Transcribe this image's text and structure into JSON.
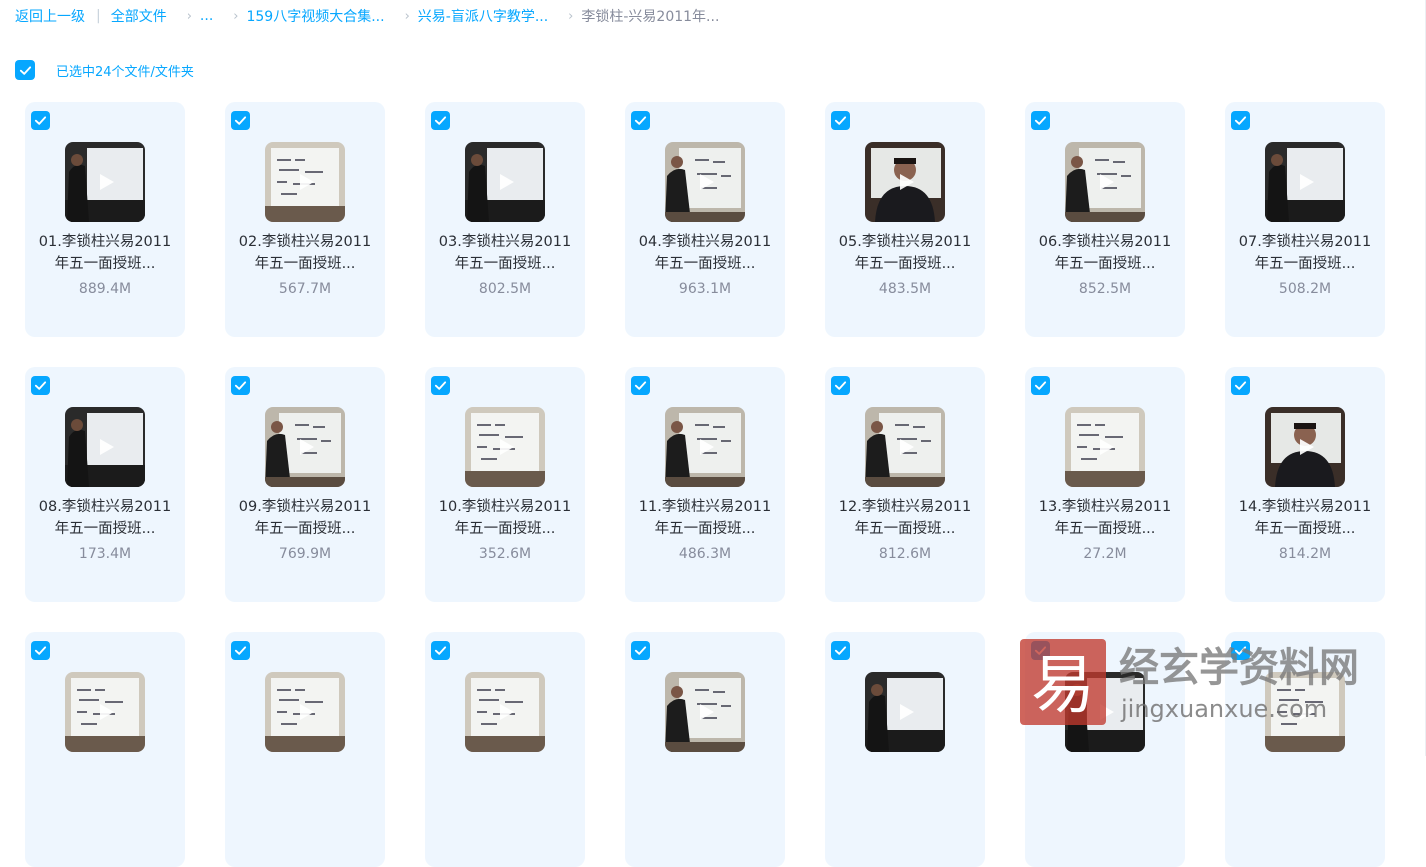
{
  "breadcrumb": {
    "back": "返回上一级",
    "all_files": "全部文件",
    "ellipsis": "...",
    "folder1": "159八字视频大合集...",
    "folder2": "兴易-盲派八字教学...",
    "current": "李锁柱-兴易2011年..."
  },
  "selection": {
    "label": "已选中24个文件/文件夹",
    "all_checked": true
  },
  "files": [
    {
      "name": "01.李锁柱兴易2011年五一面授班...",
      "size": "889.4M",
      "checked": true,
      "scene": "dark-left"
    },
    {
      "name": "02.李锁柱兴易2011年五一面授班...",
      "size": "567.7M",
      "checked": true,
      "scene": "board"
    },
    {
      "name": "03.李锁柱兴易2011年五一面授班...",
      "size": "802.5M",
      "checked": true,
      "scene": "dark-left"
    },
    {
      "name": "04.李锁柱兴易2011年五一面授班...",
      "size": "963.1M",
      "checked": true,
      "scene": "board-person"
    },
    {
      "name": "05.李锁柱兴易2011年五一面授班...",
      "size": "483.5M",
      "checked": true,
      "scene": "face"
    },
    {
      "name": "06.李锁柱兴易2011年五一面授班...",
      "size": "852.5M",
      "checked": true,
      "scene": "board-person"
    },
    {
      "name": "07.李锁柱兴易2011年五一面授班...",
      "size": "508.2M",
      "checked": true,
      "scene": "dark-left"
    },
    {
      "name": "08.李锁柱兴易2011年五一面授班...",
      "size": "173.4M",
      "checked": true,
      "scene": "dark-left"
    },
    {
      "name": "09.李锁柱兴易2011年五一面授班...",
      "size": "769.9M",
      "checked": true,
      "scene": "board-person"
    },
    {
      "name": "10.李锁柱兴易2011年五一面授班...",
      "size": "352.6M",
      "checked": true,
      "scene": "board"
    },
    {
      "name": "11.李锁柱兴易2011年五一面授班...",
      "size": "486.3M",
      "checked": true,
      "scene": "board-person"
    },
    {
      "name": "12.李锁柱兴易2011年五一面授班...",
      "size": "812.6M",
      "checked": true,
      "scene": "board-person"
    },
    {
      "name": "13.李锁柱兴易2011年五一面授班...",
      "size": "27.2M",
      "checked": true,
      "scene": "board"
    },
    {
      "name": "14.李锁柱兴易2011年五一面授班...",
      "size": "814.2M",
      "checked": true,
      "scene": "face"
    },
    {
      "name": "",
      "size": "",
      "checked": true,
      "scene": "board"
    },
    {
      "name": "",
      "size": "",
      "checked": true,
      "scene": "board"
    },
    {
      "name": "",
      "size": "",
      "checked": true,
      "scene": "board"
    },
    {
      "name": "",
      "size": "",
      "checked": true,
      "scene": "board-person"
    },
    {
      "name": "",
      "size": "",
      "checked": true,
      "scene": "dark-left"
    },
    {
      "name": "",
      "size": "",
      "checked": true,
      "scene": "dark-left"
    },
    {
      "name": "",
      "size": "",
      "checked": true,
      "scene": "board"
    }
  ],
  "watermark": {
    "seal_char": "易",
    "title": "经玄学资料网",
    "url": "jingxuanxue.com"
  },
  "colors": {
    "accent": "#06a7ff",
    "card_bg": "#eef6fe",
    "watermark_red": "#c23a2e"
  }
}
